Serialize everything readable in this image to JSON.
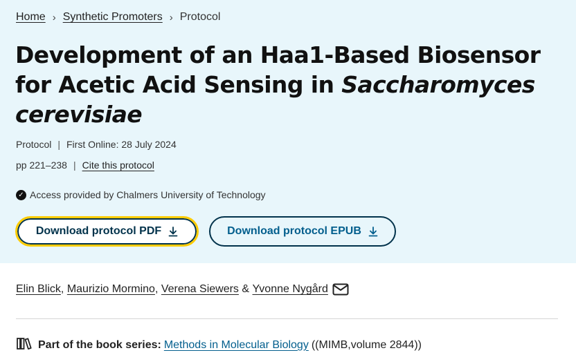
{
  "breadcrumb": {
    "home": "Home",
    "section": "Synthetic Promoters",
    "current": "Protocol",
    "separator": "›"
  },
  "title": {
    "plain": "Development of an Haa1-Based Biosensor for Acetic Acid Sensing in",
    "italic": "Saccharomyces cerevisiae"
  },
  "meta": {
    "type": "Protocol",
    "first_online": "First Online: 28 July 2024",
    "pages": "pp 221–238",
    "cite": "Cite this protocol",
    "separator": "|"
  },
  "access": {
    "text": "Access provided by Chalmers University of Technology",
    "icon": "check-circle-icon"
  },
  "buttons": {
    "pdf": "Download protocol PDF",
    "epub": "Download protocol EPUB",
    "icon": "download-icon"
  },
  "authors": {
    "list": [
      "Elin Blick",
      "Maurizio Mormino",
      "Verena Siewers",
      "Yvonne Nygård"
    ],
    "sep_comma": ",",
    "sep_amp": "&",
    "icon": "mail-icon"
  },
  "series": {
    "label": "Part of the book series:",
    "link": "Methods in Molecular Biology",
    "suffix": "((MIMB,volume 2844))",
    "icon": "books-icon"
  },
  "colors": {
    "hero_bg": "#e8f6fb",
    "button_border": "#01324b",
    "focus_ring": "#ffcc00",
    "link": "#025e8d"
  }
}
